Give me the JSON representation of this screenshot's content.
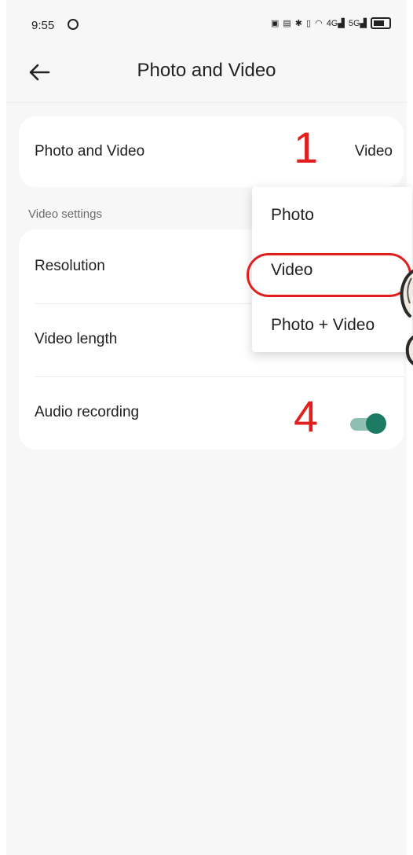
{
  "status_bar": {
    "time": "9:55",
    "signal_1": "4G",
    "signal_2": "5G"
  },
  "header": {
    "title": "Photo and Video"
  },
  "capture_mode": {
    "label": "Photo and Video",
    "value": "Video"
  },
  "video_settings": {
    "section_title": "Video settings",
    "rows": [
      {
        "label": "Resolution"
      },
      {
        "label": "Video length"
      },
      {
        "label": "Audio recording",
        "toggle_on": true
      }
    ]
  },
  "dropdown": {
    "options": [
      "Photo",
      "Video",
      "Photo + Video"
    ],
    "highlighted": "Video"
  },
  "annotations": {
    "step_1": "1",
    "step_4": "4"
  },
  "colors": {
    "toggle_thumb": "#1d7a63",
    "toggle_track": "#8fbfb0",
    "annotation": "#e11f1f"
  }
}
